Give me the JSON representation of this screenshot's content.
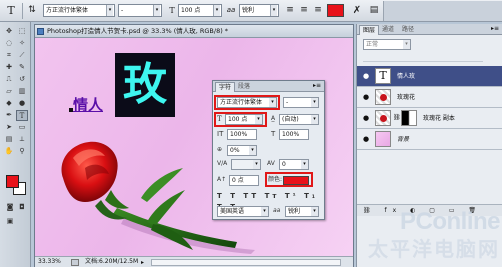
{
  "options_bar": {
    "text_tool_icon": "T",
    "font_family": "方正流行体繁体",
    "font_style": "-",
    "font_size": "100 点",
    "antialias_label": "aa",
    "antialias": "锐利",
    "color": "#e8121a"
  },
  "document": {
    "title": "Photoshop打造情人节贺卡.psd @ 33.3% (情人玫, RGB/8) *",
    "canvas_text": "情人",
    "big_char": "玫",
    "zoom": "33.33%",
    "doc_size": "文档:6.20M/12.5M"
  },
  "character_panel": {
    "tabs": [
      "字符",
      "段落"
    ],
    "font_family": "方正流行体繁体",
    "font_style": "-",
    "font_size": "100 点",
    "leading": "(自动)",
    "vertical_scale": "100%",
    "horizontal_scale": "100%",
    "tsume": "0%",
    "tracking": "0",
    "baseline_shift": "0 点",
    "color_label": "颜色:",
    "color": "#e8121a",
    "language": "美国英语",
    "antialias_label": "aa",
    "antialias": "锐利"
  },
  "layers_panel": {
    "tabs": [
      "图层",
      "通道",
      "路径"
    ],
    "blend_mode": "正常",
    "layers": [
      {
        "name": "情人玫",
        "type": "text",
        "selected": true
      },
      {
        "name": "玫瑰花",
        "type": "image",
        "selected": false
      },
      {
        "name": "玫瑰花 副本",
        "type": "image",
        "selected": false
      },
      {
        "name": "背景",
        "type": "background",
        "selected": false
      }
    ]
  },
  "watermark": {
    "brand": "PConline",
    "subtitle": "太平洋电脑网"
  },
  "colors": {
    "foreground": "#e8121a",
    "background": "#ffffff",
    "canvas_pink": "#eeb8ec",
    "text_purple": "#5a0fa8",
    "char_cyan": "#3ef6f0"
  }
}
